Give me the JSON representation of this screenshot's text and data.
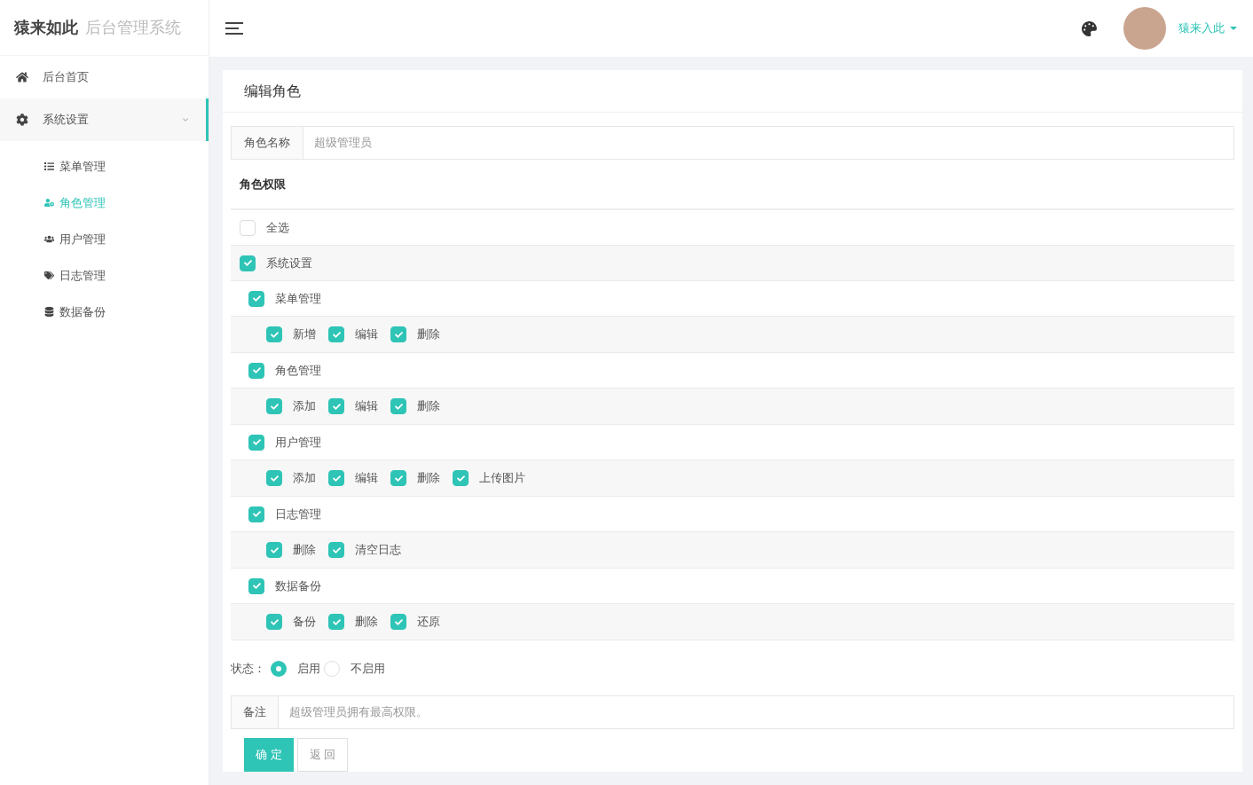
{
  "logo": {
    "brand": "猿来如此",
    "subtitle": "后台管理系统"
  },
  "header": {
    "user": "猿来入此"
  },
  "sidebar": {
    "items": [
      {
        "label": "后台首页",
        "selected": false
      },
      {
        "label": "系统设置",
        "selected": true,
        "expanded": true,
        "children": [
          {
            "label": "菜单管理",
            "selected": false
          },
          {
            "label": "角色管理",
            "selected": true
          },
          {
            "label": "用户管理",
            "selected": false
          },
          {
            "label": "日志管理",
            "selected": false
          },
          {
            "label": "数据备份",
            "selected": false
          }
        ]
      }
    ]
  },
  "card": {
    "title": "编辑角色"
  },
  "role_name": {
    "label": "角色名称",
    "value": "超级管理员"
  },
  "permissions": {
    "heading": "角色权限",
    "select_all": {
      "label": "全选",
      "checked": false
    },
    "tree": [
      {
        "label": "系统设置",
        "checked": true,
        "children": [
          {
            "label": "菜单管理",
            "checked": true,
            "children": [
              {
                "label": "新增",
                "checked": true
              },
              {
                "label": "编辑",
                "checked": true
              },
              {
                "label": "删除",
                "checked": true
              }
            ]
          },
          {
            "label": "角色管理",
            "checked": true,
            "children": [
              {
                "label": "添加",
                "checked": true
              },
              {
                "label": "编辑",
                "checked": true
              },
              {
                "label": "删除",
                "checked": true
              }
            ]
          },
          {
            "label": "用户管理",
            "checked": true,
            "children": [
              {
                "label": "添加",
                "checked": true
              },
              {
                "label": "编辑",
                "checked": true
              },
              {
                "label": "删除",
                "checked": true
              },
              {
                "label": "上传图片",
                "checked": true
              }
            ]
          },
          {
            "label": "日志管理",
            "checked": true,
            "children": [
              {
                "label": "删除",
                "checked": true
              },
              {
                "label": "清空日志",
                "checked": true
              }
            ]
          },
          {
            "label": "数据备份",
            "checked": true,
            "children": [
              {
                "label": "备份",
                "checked": true
              },
              {
                "label": "删除",
                "checked": true
              },
              {
                "label": "还原",
                "checked": true
              }
            ]
          }
        ]
      }
    ]
  },
  "status": {
    "label": "状态：",
    "options": [
      {
        "label": "启用",
        "selected": true
      },
      {
        "label": "不启用",
        "selected": false
      }
    ]
  },
  "remark": {
    "label": "备注",
    "value": "超级管理员拥有最高权限。"
  },
  "buttons": [
    {
      "label": "确 定",
      "kind": "primary"
    },
    {
      "label": "返 回",
      "kind": "default"
    }
  ]
}
